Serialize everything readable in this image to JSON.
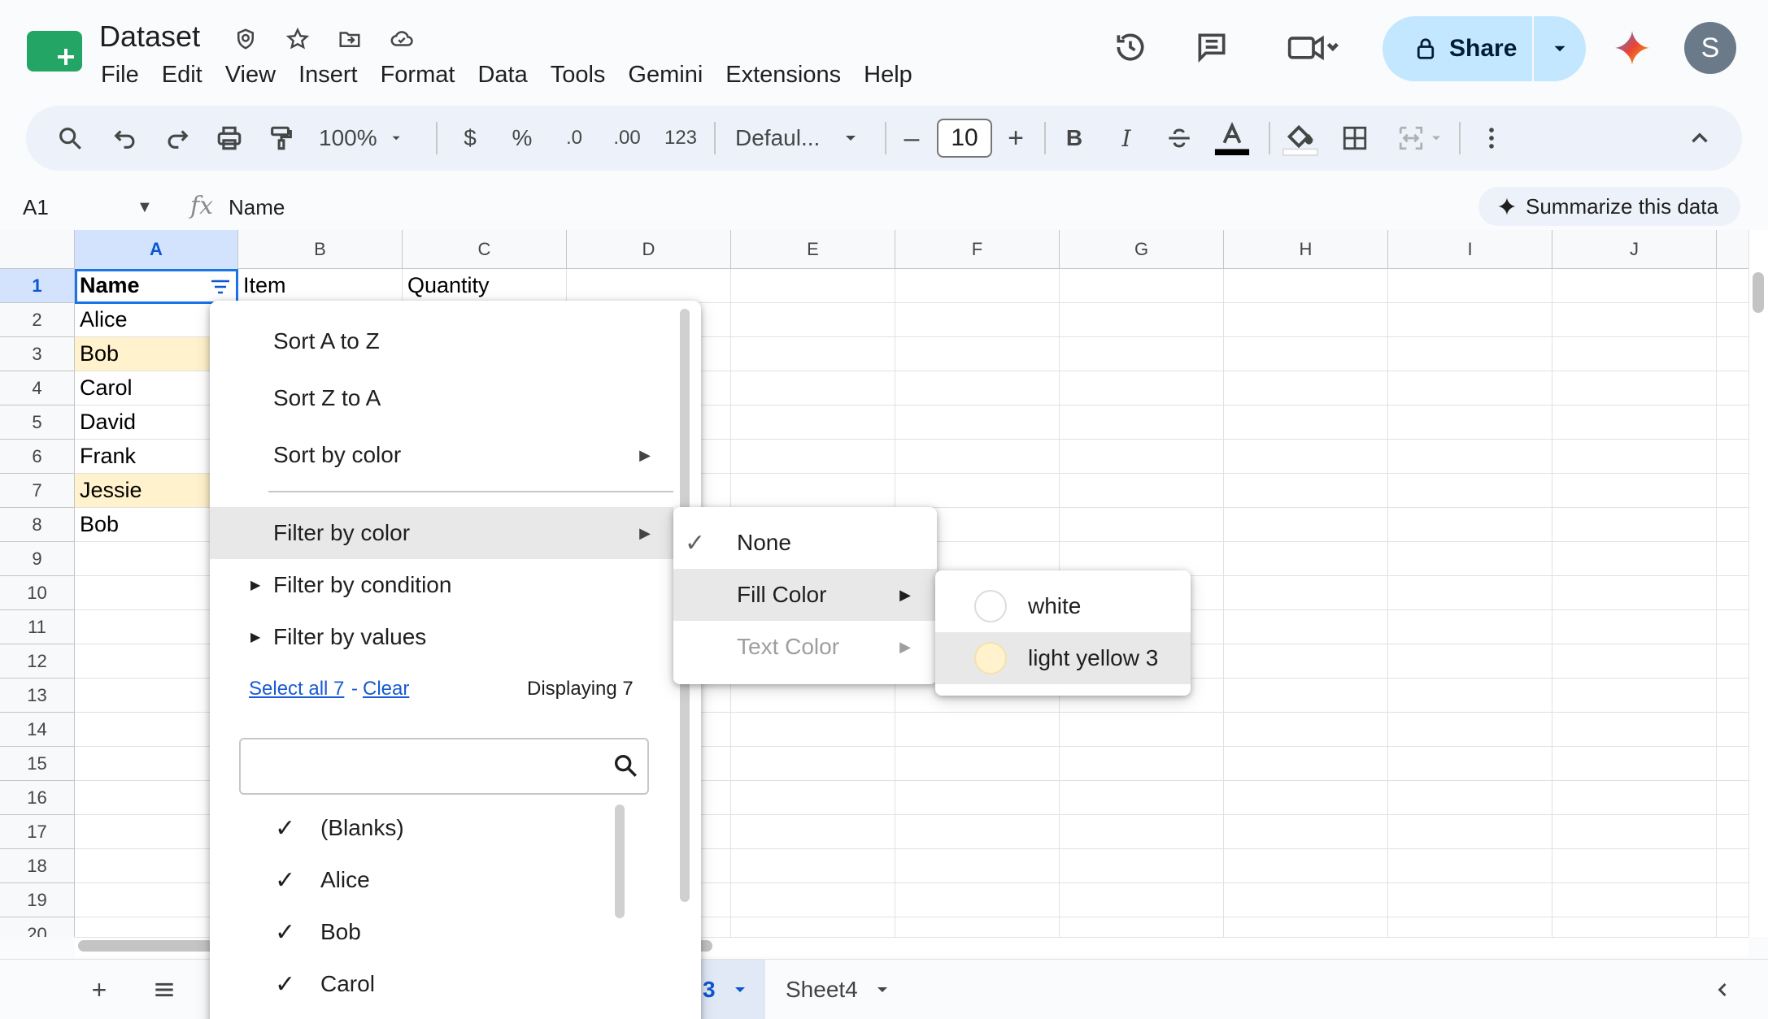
{
  "doc": {
    "title": "Dataset"
  },
  "menubar": [
    "File",
    "Edit",
    "View",
    "Insert",
    "Format",
    "Data",
    "Tools",
    "Gemini",
    "Extensions",
    "Help"
  ],
  "header": {
    "share_label": "Share",
    "avatar_letter": "S"
  },
  "toolbar": {
    "zoom": "100%",
    "currency": "$",
    "percent": "%",
    "dec_decrease": ".0",
    "dec_increase": ".00",
    "number_format": "123",
    "font": "Defaul...",
    "font_size": "10",
    "bold": "B",
    "italic": "I"
  },
  "formula_bar": {
    "cell_ref": "A1",
    "fx": "fx",
    "value": "Name",
    "summarize_label": "Summarize this data"
  },
  "grid": {
    "columns": [
      "A",
      "B",
      "C",
      "D",
      "E",
      "F",
      "G",
      "H",
      "I",
      "J"
    ],
    "rows": [
      "1",
      "2",
      "3",
      "4",
      "5",
      "6",
      "7",
      "8",
      "9",
      "10",
      "11",
      "12",
      "13",
      "14",
      "15",
      "16",
      "17",
      "18",
      "19",
      "20"
    ],
    "header_row": [
      "Name",
      "Item",
      "Quantity"
    ],
    "column_a": [
      "Alice",
      "Bob",
      "Carol",
      "David",
      "Frank",
      "Jessie",
      "Bob"
    ],
    "fill_colors": {
      "light_yellow_3": "#fff2cc",
      "white": "#ffffff"
    }
  },
  "filter_menu": {
    "sort_az": "Sort A to Z",
    "sort_za": "Sort Z to A",
    "sort_by_color": "Sort by color",
    "filter_by_color": "Filter by color",
    "filter_by_condition": "Filter by condition",
    "filter_by_values": "Filter by values",
    "select_all": "Select all 7",
    "dash": "-",
    "clear": "Clear",
    "displaying": "Displaying 7",
    "values": [
      "(Blanks)",
      "Alice",
      "Bob",
      "Carol"
    ]
  },
  "color_submenu": {
    "none": "None",
    "fill_color": "Fill Color",
    "text_color": "Text Color"
  },
  "fill_submenu": {
    "white": "white",
    "light_yellow_3": "light yellow 3"
  },
  "sheet_tabs": {
    "active_partial": "3",
    "sheet4": "Sheet4"
  }
}
